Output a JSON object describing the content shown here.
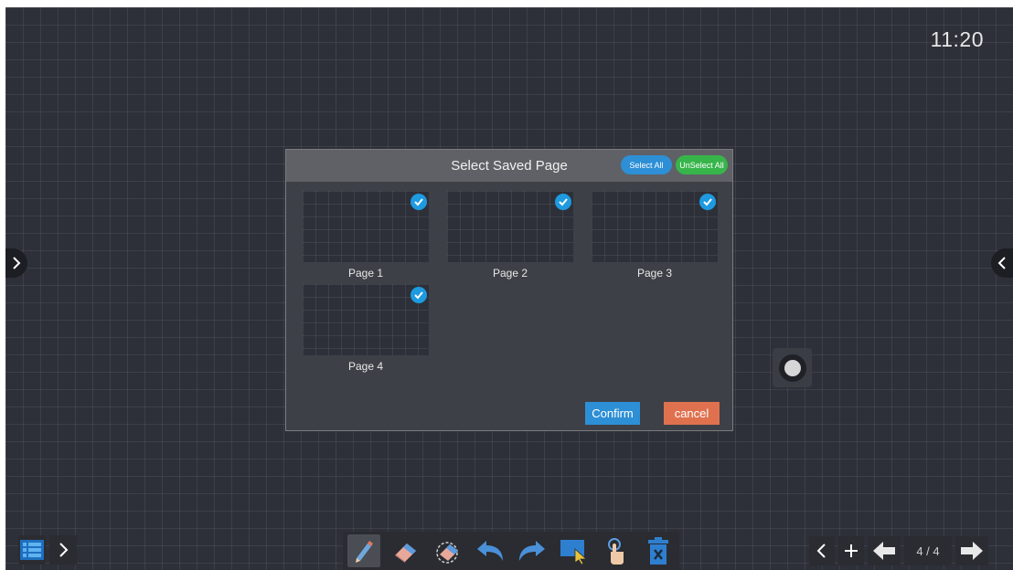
{
  "clock": "11:20",
  "dialog": {
    "title": "Select Saved Page",
    "select_all": "Select All",
    "unselect_all": "UnSelect All",
    "pages": [
      {
        "label": "Page 1",
        "checked": true
      },
      {
        "label": "Page 2",
        "checked": true
      },
      {
        "label": "Page 3",
        "checked": true
      },
      {
        "label": "Page 4",
        "checked": true
      }
    ],
    "confirm": "Confirm",
    "cancel": "cancel"
  },
  "toolbar": {
    "tools": [
      "pen-icon",
      "eraser-icon",
      "area-eraser-icon",
      "undo-icon",
      "redo-icon",
      "select-icon",
      "touch-icon",
      "delete-icon"
    ],
    "active_tool": "pen-icon"
  },
  "page_nav": {
    "counter": "4 / 4"
  },
  "colors": {
    "board": "#2d3038",
    "accent_blue": "#2d8fd6",
    "accent_green": "#37b54a",
    "cancel_orange": "#e0714e"
  }
}
